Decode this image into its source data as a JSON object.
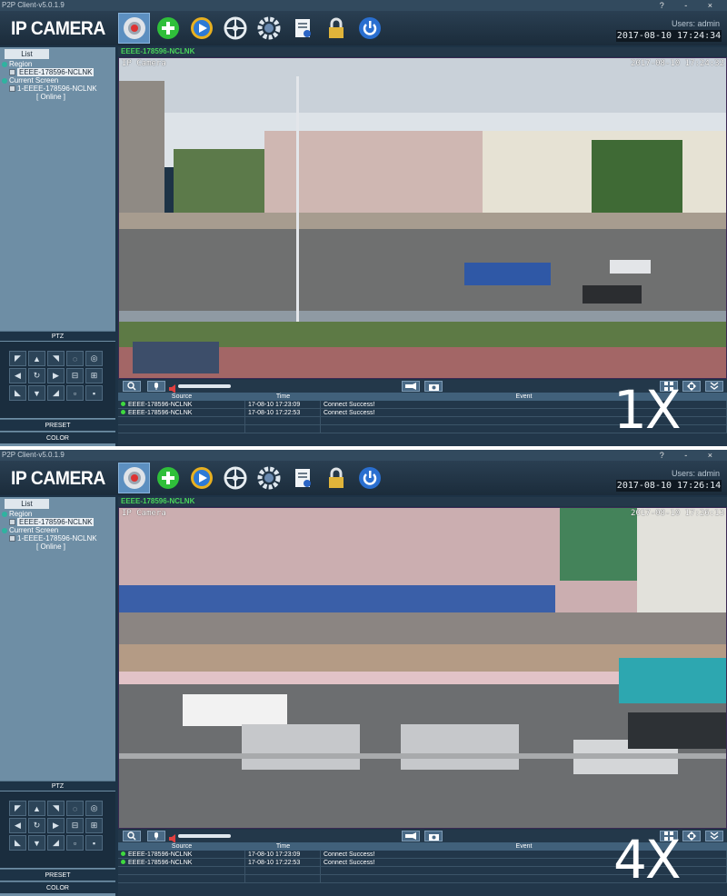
{
  "app": {
    "title": "P2P Client-v5.0.1.9",
    "logo": "IP CAMERA",
    "window_buttons": "? - ×",
    "users": "Users: admin"
  },
  "toolbar": [
    "camera-icon",
    "add-icon",
    "playback-icon",
    "ptz-icon",
    "settings-icon",
    "log-icon",
    "lock-icon",
    "power-icon"
  ],
  "sidebar": {
    "tab": "List",
    "region": "Region",
    "region_device": "EEEE-178596-NCLNK",
    "current_screen": "Current Screen",
    "screen_device": "1-EEEE-178596-NCLNK",
    "status": "[   Online   ]",
    "ptz": "PTZ",
    "preset": "PRESET",
    "color": "COLOR"
  },
  "video": {
    "channel": "EEEE-178596-NCLNK",
    "osd_name": "IP Camera"
  },
  "events": {
    "columns": [
      "Source",
      "Time",
      "Event"
    ],
    "rows": [
      {
        "source": "EEEE-178596-NCLNK",
        "time": "17-08-10 17:23:09",
        "event": "Connect Success!"
      },
      {
        "source": "EEEE-178596-NCLNK",
        "time": "17-08-10 17:22:53",
        "event": "Connect Success!"
      }
    ]
  },
  "panels": [
    {
      "clock": "2017-08-10 17:24:34",
      "osd_time": "2017-08-10 17:24:32",
      "zoom": "1X"
    },
    {
      "clock": "2017-08-10 17:26:14",
      "osd_time": "2017-08-10 17:26:13",
      "zoom": "4X"
    }
  ],
  "colors": {
    "bg": "#1d3346",
    "sidebar": "#6e8ea5",
    "channel_green": "#49d45b",
    "online_dot": "#3fd93f"
  }
}
